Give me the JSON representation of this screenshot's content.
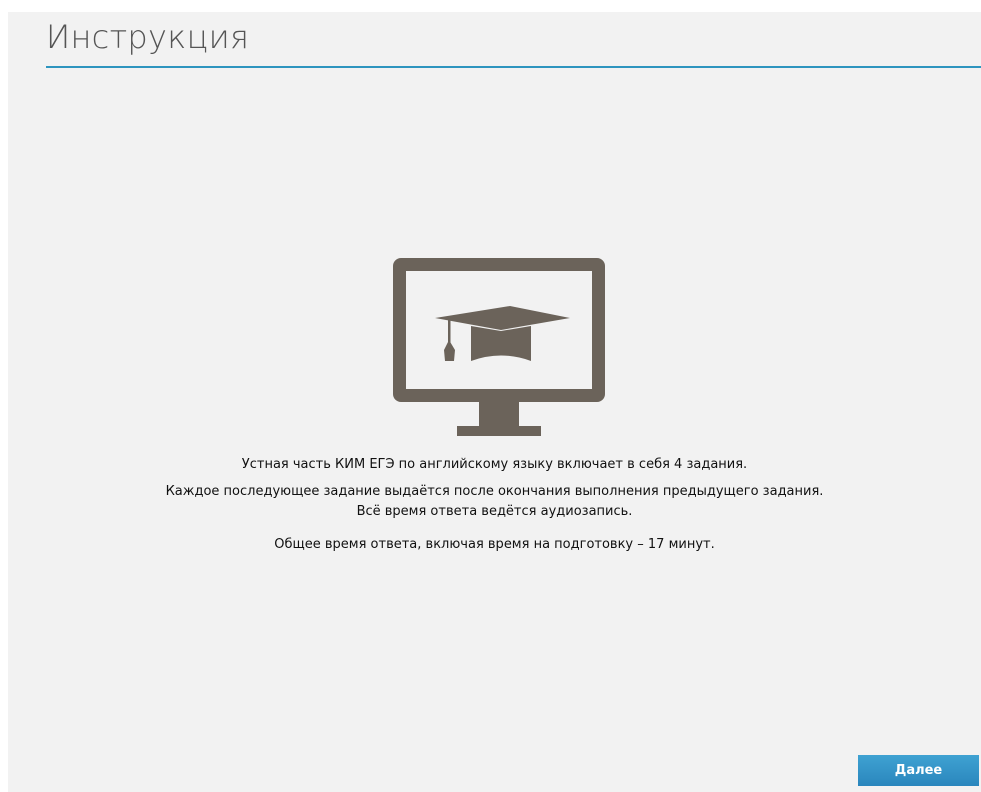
{
  "header": {
    "title": "Инструкция"
  },
  "illustration": {
    "icon": "monitor-graduation-cap-icon",
    "color": "#6b635a"
  },
  "instructions": {
    "line1": "Устная часть КИМ ЕГЭ по английскому языку включает в себя 4 задания.",
    "line2": "Каждое последующее задание выдаётся после окончания выполнения предыдущего задания.",
    "line3": "Всё время ответа ведётся аудиозапись.",
    "line4": "Общее время ответа, включая время на подготовку – 17 минут."
  },
  "footer": {
    "next_label": "Далее"
  },
  "colors": {
    "accent": "#2e95bf",
    "background": "#f2f2f2",
    "button": "#2a8fc4"
  }
}
